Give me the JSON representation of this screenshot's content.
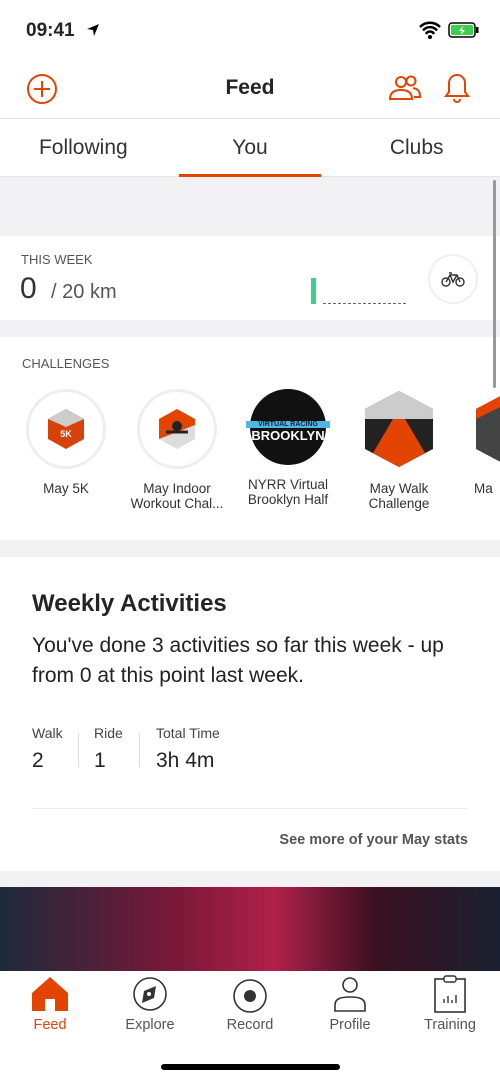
{
  "status": {
    "time": "09:41"
  },
  "nav": {
    "title": "Feed"
  },
  "tabs": [
    {
      "label": "Following"
    },
    {
      "label": "You",
      "active": true
    },
    {
      "label": "Clubs"
    }
  ],
  "this_week": {
    "label": "THIS WEEK",
    "value": "0",
    "goal": "/ 20 km",
    "sport_icon": "bike-icon",
    "progress": 0
  },
  "challenges": {
    "label": "CHALLENGES",
    "items": [
      {
        "name": "May 5K"
      },
      {
        "name": "May Indoor Workout Chal..."
      },
      {
        "name": "NYRR Virtual Brooklyn Half",
        "badge_text": [
          "VIRTUAL RACING",
          "BROOKLYN"
        ]
      },
      {
        "name": "May Walk Challenge"
      },
      {
        "name": "Ma"
      }
    ]
  },
  "weekly": {
    "title": "Weekly Activities",
    "text": "You've done 3 activities so far this week - up from 0 at this point last week.",
    "stats": [
      {
        "label": "Walk",
        "value": "2"
      },
      {
        "label": "Ride",
        "value": "1"
      },
      {
        "label": "Total Time",
        "value": "3h 4m"
      }
    ],
    "link": "See more of your May stats"
  },
  "tabbar": [
    {
      "label": "Feed",
      "active": true
    },
    {
      "label": "Explore"
    },
    {
      "label": "Record"
    },
    {
      "label": "Profile"
    },
    {
      "label": "Training"
    }
  ],
  "colors": {
    "accent": "#e34402",
    "progress": "#3ccf8e"
  }
}
